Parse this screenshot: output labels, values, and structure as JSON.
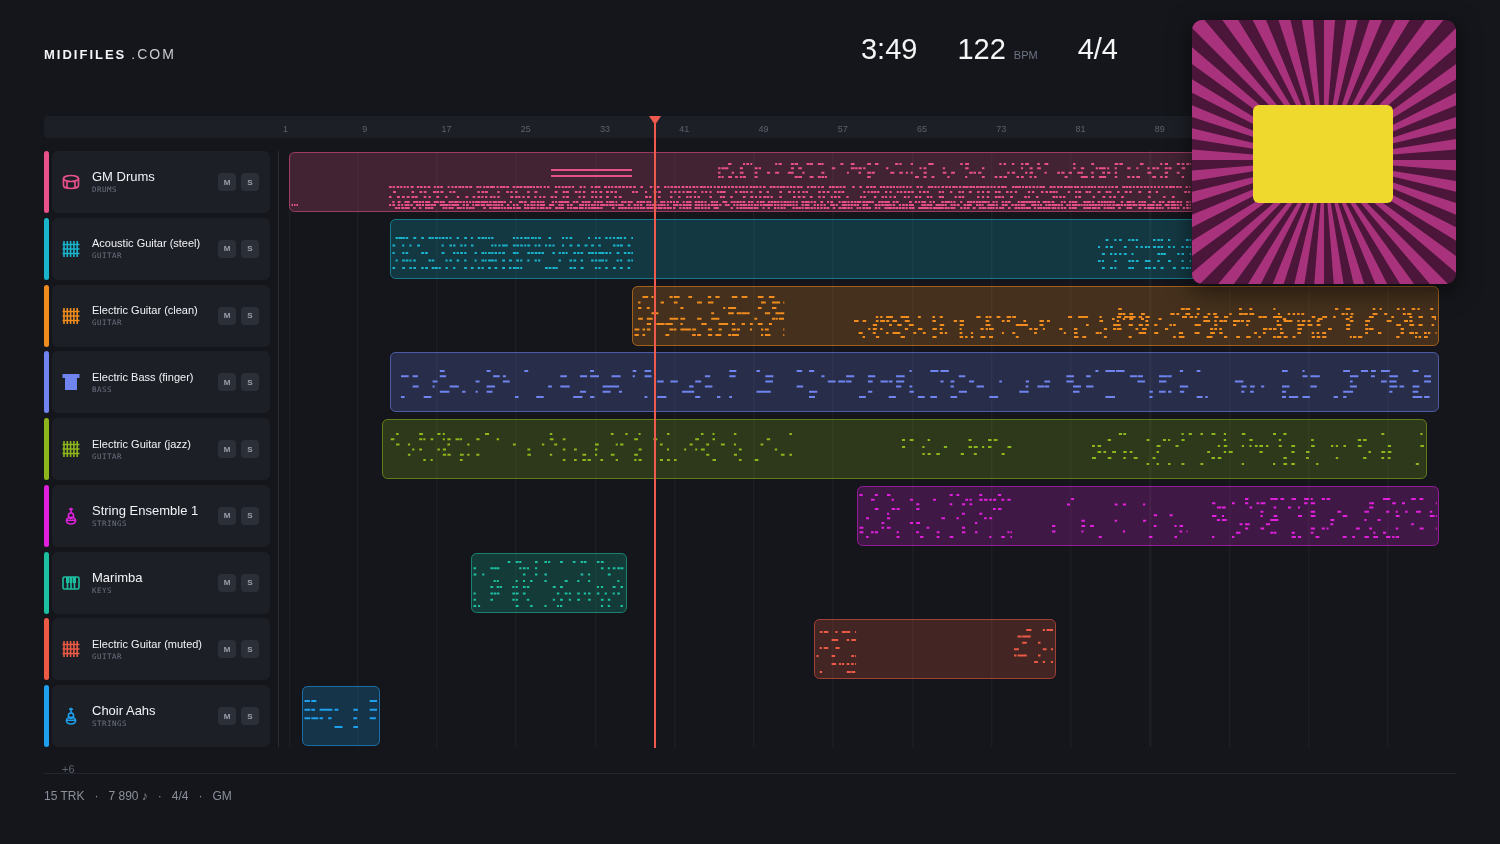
{
  "brand": {
    "name": "MIDIFILES",
    "suffix": ".COM"
  },
  "stats": {
    "duration": "3:49",
    "tempo": "122",
    "tempo_unit": "BPM",
    "time_signature": "4/4"
  },
  "ruler": {
    "labels": [
      "1",
      "9",
      "17",
      "25",
      "33",
      "41",
      "49",
      "57",
      "65",
      "73",
      "81",
      "89"
    ]
  },
  "playhead": {
    "level": 0.32
  },
  "tracks": [
    {
      "name": "GM Drums",
      "category": "DRUMS",
      "kind": "drums",
      "color": "#e8508a",
      "mute_label": "M",
      "solo_label": "S"
    },
    {
      "name": "Acoustic Guitar (steel)",
      "category": "GUITAR",
      "kind": "guitar",
      "color": "#19b3cc",
      "mute_label": "M",
      "solo_label": "S"
    },
    {
      "name": "Electric Guitar (clean)",
      "category": "GUITAR",
      "kind": "guitar",
      "color": "#f08c1e",
      "mute_label": "M",
      "solo_label": "S"
    },
    {
      "name": "Electric Bass (finger)",
      "category": "BASS",
      "kind": "bass",
      "color": "#7084f0",
      "mute_label": "M",
      "solo_label": "S"
    },
    {
      "name": "Electric Guitar (jazz)",
      "category": "GUITAR",
      "kind": "guitar",
      "color": "#8db51c",
      "mute_label": "M",
      "solo_label": "S"
    },
    {
      "name": "String Ensemble 1",
      "category": "STRINGS",
      "kind": "strings",
      "color": "#e020dc",
      "mute_label": "M",
      "solo_label": "S"
    },
    {
      "name": "Marimba",
      "category": "KEYS",
      "kind": "keys",
      "color": "#1cbfa0",
      "mute_label": "M",
      "solo_label": "S"
    },
    {
      "name": "Electric Guitar (muted)",
      "category": "GUITAR",
      "kind": "guitar",
      "color": "#ec5a45",
      "mute_label": "M",
      "solo_label": "S"
    },
    {
      "name": "Choir Aahs",
      "category": "STRINGS",
      "kind": "strings",
      "color": "#1ea0ee",
      "mute_label": "M",
      "solo_label": "S"
    }
  ],
  "more_tracks": "+6",
  "footer": {
    "items": [
      "15 TRK",
      "7 890 ♪",
      "4/4",
      "GM"
    ],
    "separators": [
      "·",
      "·",
      "·"
    ]
  }
}
